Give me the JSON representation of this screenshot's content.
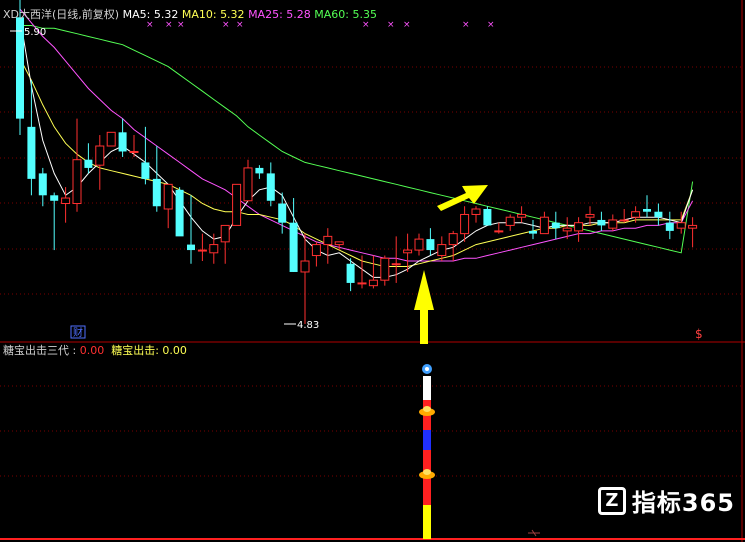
{
  "header": {
    "stock_name": "XD大西洋",
    "period": "(日线,前复权)",
    "ma5_label": "MA5:",
    "ma5_value": "5.32",
    "ma10_label": "MA10:",
    "ma10_value": "5.32",
    "ma25_label": "MA25:",
    "ma25_value": "5.28",
    "ma60_label": "MA60:",
    "ma60_value": "5.35"
  },
  "price_high_label": "5.90",
  "price_low_label": "4.83",
  "cai_marker": "财",
  "s_marker": "$",
  "indicator": {
    "name": "糖宝出击三代",
    "value1": "0.00",
    "label2": "糖宝出击:",
    "value2": "0.00"
  },
  "watermark": {
    "logo_letter": "Z",
    "text": "指标365"
  },
  "colors": {
    "background": "#000000",
    "up_candle": "#ff3030",
    "down_candle": "#54ffff",
    "ma5": "#ffffff",
    "ma10": "#ffff54",
    "ma25": "#ff54ff",
    "ma60": "#54ff54",
    "arrow": "#ffff00",
    "separator": "#b00000"
  },
  "chart_data": {
    "type": "candlestick",
    "y_low": 4.83,
    "y_high": 5.9,
    "ohlc": [
      [
        5.95,
        6.08,
        5.52,
        5.58
      ],
      [
        5.55,
        5.72,
        5.3,
        5.36
      ],
      [
        5.38,
        5.4,
        5.26,
        5.3
      ],
      [
        5.3,
        5.31,
        5.1,
        5.28
      ],
      [
        5.27,
        5.33,
        5.2,
        5.29
      ],
      [
        5.27,
        5.58,
        5.24,
        5.43
      ],
      [
        5.43,
        5.49,
        5.38,
        5.4
      ],
      [
        5.41,
        5.52,
        5.32,
        5.48
      ],
      [
        5.48,
        5.52,
        5.48,
        5.53
      ],
      [
        5.53,
        5.58,
        5.44,
        5.46
      ],
      [
        5.46,
        5.52,
        5.44,
        5.46
      ],
      [
        5.42,
        5.55,
        5.34,
        5.36
      ],
      [
        5.36,
        5.48,
        5.24,
        5.26
      ],
      [
        5.25,
        5.33,
        5.18,
        5.34
      ],
      [
        5.32,
        5.33,
        5.18,
        5.15
      ],
      [
        5.12,
        5.3,
        5.05,
        5.1
      ],
      [
        5.1,
        5.16,
        5.06,
        5.1
      ],
      [
        5.09,
        5.16,
        5.05,
        5.12
      ],
      [
        5.13,
        5.16,
        5.05,
        5.19
      ],
      [
        5.19,
        5.32,
        5.2,
        5.34
      ],
      [
        5.28,
        5.43,
        5.28,
        5.4
      ],
      [
        5.4,
        5.41,
        5.36,
        5.38
      ],
      [
        5.38,
        5.42,
        5.26,
        5.28
      ],
      [
        5.27,
        5.31,
        5.16,
        5.2
      ],
      [
        5.2,
        5.29,
        5.02,
        5.02
      ],
      [
        5.02,
        5.16,
        4.83,
        5.06
      ],
      [
        5.08,
        5.13,
        5.04,
        5.12
      ],
      [
        5.12,
        5.18,
        5.05,
        5.15
      ],
      [
        5.12,
        5.12,
        5.1,
        5.13
      ],
      [
        5.05,
        5.07,
        4.95,
        4.98
      ],
      [
        4.98,
        5.08,
        4.96,
        4.98
      ],
      [
        4.97,
        5.08,
        4.96,
        4.99
      ],
      [
        4.99,
        5.08,
        4.97,
        5.07
      ],
      [
        5.05,
        5.15,
        4.98,
        5.05
      ],
      [
        5.09,
        5.16,
        5.02,
        5.1
      ],
      [
        5.1,
        5.16,
        5.08,
        5.14
      ],
      [
        5.14,
        5.18,
        5.08,
        5.1
      ],
      [
        5.08,
        5.15,
        5.06,
        5.12
      ],
      [
        5.12,
        5.17,
        5.06,
        5.16
      ],
      [
        5.16,
        5.26,
        5.13,
        5.23
      ],
      [
        5.23,
        5.26,
        5.2,
        5.25
      ],
      [
        5.25,
        5.26,
        5.19,
        5.19
      ],
      [
        5.17,
        5.2,
        5.16,
        5.17
      ],
      [
        5.19,
        5.23,
        5.17,
        5.22
      ],
      [
        5.22,
        5.26,
        5.2,
        5.23
      ],
      [
        5.17,
        5.21,
        5.14,
        5.16
      ],
      [
        5.16,
        5.24,
        5.16,
        5.22
      ],
      [
        5.2,
        5.24,
        5.14,
        5.18
      ],
      [
        5.17,
        5.22,
        5.14,
        5.18
      ],
      [
        5.17,
        5.22,
        5.13,
        5.2
      ],
      [
        5.22,
        5.26,
        5.19,
        5.23
      ],
      [
        5.21,
        5.24,
        5.17,
        5.19
      ],
      [
        5.18,
        5.23,
        5.17,
        5.21
      ],
      [
        5.21,
        5.25,
        5.2,
        5.21
      ],
      [
        5.22,
        5.26,
        5.2,
        5.24
      ],
      [
        5.25,
        5.3,
        5.22,
        5.24
      ],
      [
        5.24,
        5.27,
        5.19,
        5.22
      ],
      [
        5.2,
        5.24,
        5.14,
        5.17
      ],
      [
        5.18,
        5.24,
        5.16,
        5.2
      ],
      [
        5.18,
        5.22,
        5.11,
        5.19
      ]
    ],
    "ma60": [
      5.92,
      5.92,
      5.91,
      5.91,
      5.9,
      5.89,
      5.88,
      5.87,
      5.86,
      5.85,
      5.83,
      5.81,
      5.79,
      5.77,
      5.74,
      5.71,
      5.68,
      5.65,
      5.62,
      5.59,
      5.55,
      5.52,
      5.49,
      5.46,
      5.44,
      5.42,
      5.41,
      5.4,
      5.39,
      5.38,
      5.37,
      5.36,
      5.35,
      5.34,
      5.33,
      5.32,
      5.31,
      5.3,
      5.29,
      5.28,
      5.27,
      5.26,
      5.25,
      5.24,
      5.23,
      5.22,
      5.21,
      5.2,
      5.19,
      5.18,
      5.17,
      5.16,
      5.15,
      5.14,
      5.13,
      5.12,
      5.11,
      5.1,
      5.09,
      5.35
    ],
    "ma25": [
      5.98,
      5.93,
      5.88,
      5.84,
      5.79,
      5.74,
      5.69,
      5.65,
      5.61,
      5.58,
      5.54,
      5.51,
      5.48,
      5.45,
      5.42,
      5.39,
      5.36,
      5.34,
      5.32,
      5.29,
      5.26,
      5.23,
      5.21,
      5.19,
      5.17,
      5.15,
      5.13,
      5.12,
      5.11,
      5.1,
      5.09,
      5.08,
      5.07,
      5.07,
      5.06,
      5.06,
      5.06,
      5.06,
      5.06,
      5.07,
      5.07,
      5.08,
      5.09,
      5.1,
      5.11,
      5.12,
      5.13,
      5.14,
      5.15,
      5.16,
      5.16,
      5.17,
      5.17,
      5.18,
      5.18,
      5.19,
      5.19,
      5.2,
      5.2,
      5.28
    ],
    "ma10": [
      5.8,
      5.72,
      5.63,
      5.55,
      5.49,
      5.45,
      5.42,
      5.4,
      5.39,
      5.38,
      5.37,
      5.36,
      5.35,
      5.34,
      5.32,
      5.3,
      5.27,
      5.25,
      5.24,
      5.24,
      5.23,
      5.23,
      5.22,
      5.21,
      5.19,
      5.16,
      5.14,
      5.12,
      5.1,
      5.08,
      5.06,
      5.05,
      5.04,
      5.04,
      5.04,
      5.05,
      5.06,
      5.07,
      5.08,
      5.1,
      5.12,
      5.13,
      5.14,
      5.15,
      5.16,
      5.17,
      5.18,
      5.18,
      5.19,
      5.19,
      5.19,
      5.2,
      5.2,
      5.2,
      5.21,
      5.21,
      5.21,
      5.21,
      5.21,
      5.32
    ],
    "ma5": [
      5.95,
      5.7,
      5.5,
      5.38,
      5.3,
      5.33,
      5.38,
      5.42,
      5.46,
      5.48,
      5.45,
      5.42,
      5.38,
      5.34,
      5.28,
      5.22,
      5.17,
      5.14,
      5.15,
      5.22,
      5.28,
      5.32,
      5.33,
      5.3,
      5.22,
      5.14,
      5.1,
      5.08,
      5.09,
      5.06,
      5.03,
      5.0,
      5.0,
      5.01,
      5.03,
      5.06,
      5.08,
      5.1,
      5.11,
      5.14,
      5.17,
      5.19,
      5.2,
      5.2,
      5.2,
      5.19,
      5.18,
      5.19,
      5.19,
      5.19,
      5.2,
      5.2,
      5.2,
      5.21,
      5.22,
      5.22,
      5.22,
      5.21,
      5.2,
      5.32
    ]
  }
}
